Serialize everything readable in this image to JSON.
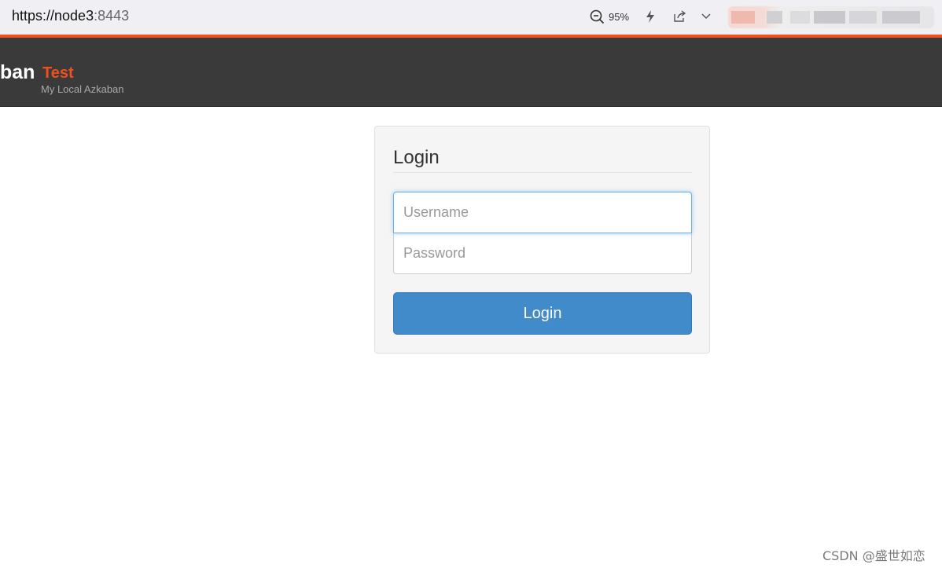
{
  "browser": {
    "url_host": "https://node3",
    "url_port": ":8443",
    "zoom": "95%",
    "icons": [
      "zoom-out-icon",
      "lightning-icon",
      "share-icon",
      "chevron-down-icon"
    ]
  },
  "header": {
    "brand": "ban",
    "environment": "Test",
    "subtitle": "My Local Azkaban"
  },
  "login": {
    "title": "Login",
    "username_placeholder": "Username",
    "username_value": "",
    "password_placeholder": "Password",
    "password_value": "",
    "button_label": "Login"
  },
  "colors": {
    "accent": "#f14f1d",
    "header_bg": "#3a3a3a",
    "button": "#428bca"
  },
  "watermark": "CSDN @盛世如恋"
}
